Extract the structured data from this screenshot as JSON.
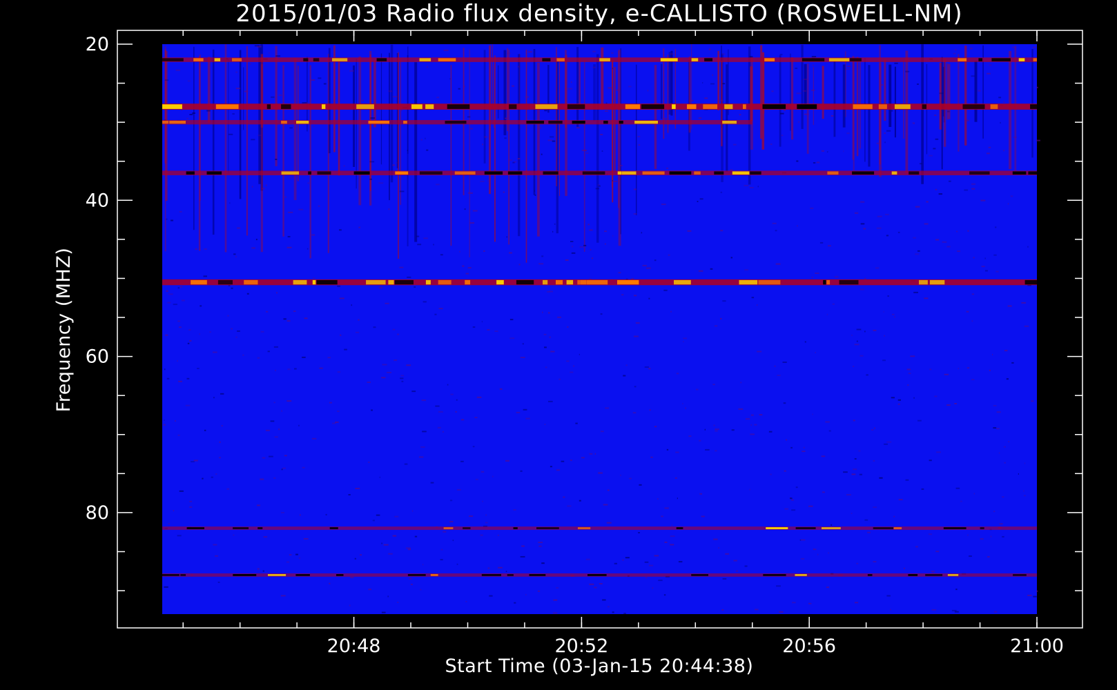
{
  "chart_data": {
    "type": "heatmap",
    "title": "2015/01/03  Radio flux density, e-CALLISTO (ROSWELL-NM)",
    "xlabel": "Start Time (03-Jan-15 20:44:38)",
    "ylabel": "Frequency (MHZ)",
    "x_range": [
      "20:44:38",
      "21:00:00"
    ],
    "y_range_mhz": [
      20,
      93
    ],
    "y_axis_inverted": true,
    "x_ticks": [
      "20:48",
      "20:52",
      "20:56",
      "21:00"
    ],
    "y_ticks": [
      20,
      40,
      60,
      80
    ],
    "grid": false,
    "colormap": [
      "#000000",
      "#0000ff",
      "#ff0000",
      "#ffff00"
    ],
    "background_color": "#0a10f0",
    "features": [
      {
        "kind": "horizontal-band",
        "frequency_mhz": 22,
        "t_start": "20:44:38",
        "t_end": "21:00:00",
        "intensity": 0.6
      },
      {
        "kind": "horizontal-band",
        "frequency_mhz": 28,
        "t_start": "20:44:38",
        "t_end": "21:00:00",
        "intensity": 0.95
      },
      {
        "kind": "horizontal-band",
        "frequency_mhz": 30,
        "t_start": "20:44:38",
        "t_end": "20:55:00",
        "intensity": 0.55
      },
      {
        "kind": "horizontal-band",
        "frequency_mhz": 36.5,
        "t_start": "20:44:38",
        "t_end": "21:00:00",
        "intensity": 0.6
      },
      {
        "kind": "horizontal-band",
        "frequency_mhz": 50.5,
        "t_start": "20:44:38",
        "t_end": "21:00:00",
        "intensity": 0.9
      },
      {
        "kind": "horizontal-band",
        "frequency_mhz": 82,
        "t_start": "20:44:38",
        "t_end": "21:00:00",
        "intensity": 0.3
      },
      {
        "kind": "horizontal-band",
        "frequency_mhz": 88,
        "t_start": "20:44:38",
        "t_end": "21:00:00",
        "intensity": 0.3
      }
    ]
  }
}
